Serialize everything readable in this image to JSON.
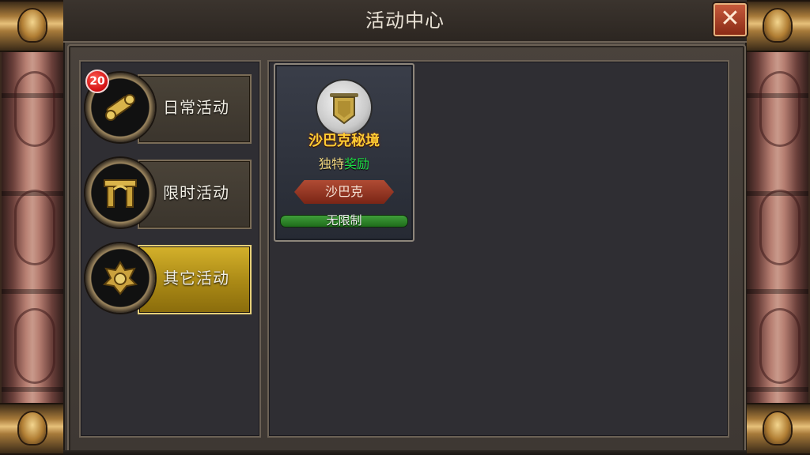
{
  "window": {
    "title": "活动中心"
  },
  "close_button": {
    "glyph": "✕",
    "icon": "close-icon"
  },
  "categories": [
    {
      "label": "日常活动",
      "icon": "scroll-icon",
      "badge": "20",
      "active": false
    },
    {
      "label": "限时活动",
      "icon": "gate-icon",
      "badge": null,
      "active": false
    },
    {
      "label": "其它活动",
      "icon": "dragon-emblem-icon",
      "badge": null,
      "active": true
    }
  ],
  "activity_card": {
    "icon": "banner-emblem-icon",
    "name": "沙巴克秘境",
    "reward_part1": "独特",
    "reward_part2": "奖励",
    "tag": "沙巴克",
    "limit": "无限制"
  },
  "colors": {
    "accent_gold": "#d4b12b",
    "name_gold": "#ffcc33",
    "reward_green": "#1fdc46",
    "badge_red": "#d10f12"
  }
}
